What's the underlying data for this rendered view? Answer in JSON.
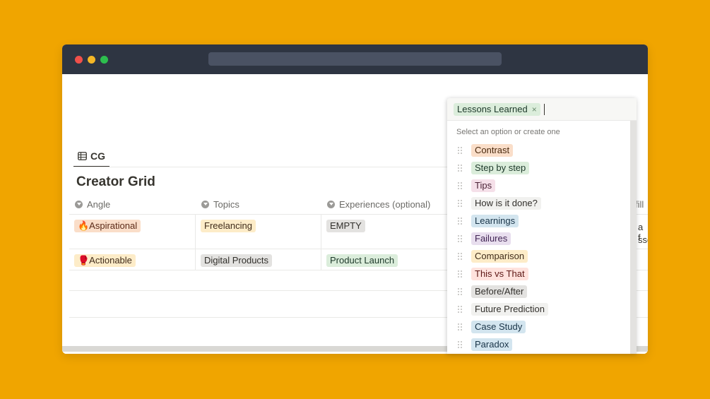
{
  "view_tab": {
    "label": "CG"
  },
  "database": {
    "title": "Creator Grid"
  },
  "columns": [
    {
      "label": "Angle"
    },
    {
      "label": "Topics"
    },
    {
      "label": "Experiences (optional)"
    },
    {
      "label": "fill"
    }
  ],
  "rows": [
    {
      "angle": {
        "label": "🔥Aspirational",
        "bg": "#FADEC9",
        "fg": "#5C2B18"
      },
      "topic": {
        "label": "Freelancing",
        "bg": "#FDECC8",
        "fg": "#402C1B"
      },
      "experience": {
        "label": "EMPTY",
        "bg": "#E3E2E0",
        "fg": "#32302C"
      },
      "fill_clip": [
        "a f",
        "sso"
      ]
    },
    {
      "angle": {
        "label": "🥊Actionable",
        "bg": "#FDECC8",
        "fg": "#402C1B"
      },
      "topic": {
        "label": "Digital Products",
        "bg": "#E3E2E0",
        "fg": "#32302C"
      },
      "experience": {
        "label": "Product Launch",
        "bg": "#DBEDDB",
        "fg": "#1C3829"
      }
    }
  ],
  "dropdown": {
    "selected": {
      "label": "Lessons Learned",
      "remove": "×"
    },
    "hint": "Select an option or create one",
    "options": [
      {
        "label": "Contrast",
        "bg": "#FADEC9",
        "fg": "#49290E"
      },
      {
        "label": "Step by step",
        "bg": "#DBEDDB",
        "fg": "#1C3829"
      },
      {
        "label": "Tips",
        "bg": "#F5E0E9",
        "fg": "#4C2337"
      },
      {
        "label": "How is it done?",
        "bg": "#F1F1EF",
        "fg": "#32302C"
      },
      {
        "label": "Learnings",
        "bg": "#D3E5EF",
        "fg": "#183347"
      },
      {
        "label": "Failures",
        "bg": "#E8DEEE",
        "fg": "#412454"
      },
      {
        "label": "Comparison",
        "bg": "#FDECC8",
        "fg": "#402C1B"
      },
      {
        "label": "This vs That",
        "bg": "#FFE2DD",
        "fg": "#5D1715"
      },
      {
        "label": "Before/After",
        "bg": "#E3E2E0",
        "fg": "#32302C"
      },
      {
        "label": "Future Prediction",
        "bg": "#F1F1EF",
        "fg": "#32302C"
      },
      {
        "label": "Case Study",
        "bg": "#D3E5EF",
        "fg": "#183347"
      },
      {
        "label": "Paradox",
        "bg": "#D3E5EF",
        "fg": "#183347"
      }
    ]
  }
}
